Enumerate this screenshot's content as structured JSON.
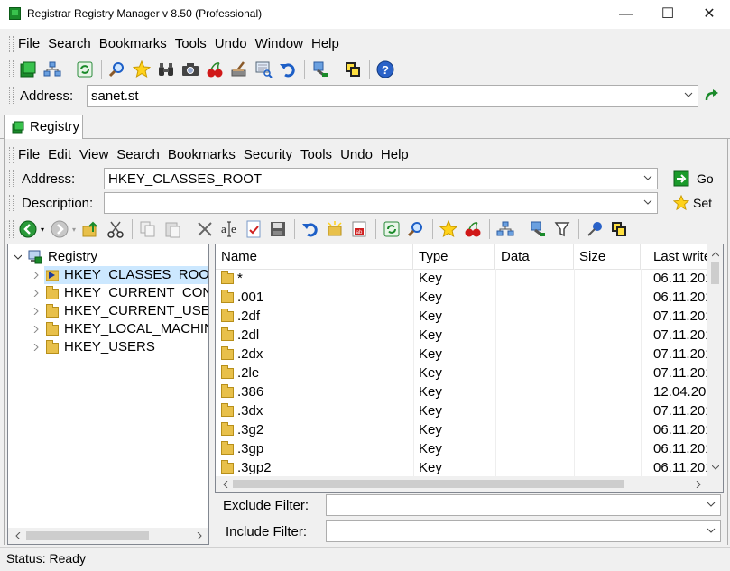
{
  "window": {
    "title": "Registrar Registry Manager v 8.50 (Professional)",
    "min": "—",
    "max": "☐",
    "close": "✕"
  },
  "main_menu": [
    "File",
    "Search",
    "Bookmarks",
    "Tools",
    "Undo",
    "Window",
    "Help"
  ],
  "main_address": {
    "label": "Address:",
    "value": "sanet.st"
  },
  "tab": {
    "label": "Registry"
  },
  "sub_menu": [
    "File",
    "Edit",
    "View",
    "Search",
    "Bookmarks",
    "Security",
    "Tools",
    "Undo",
    "Help"
  ],
  "reg_address": {
    "label": "Address:",
    "value": "HKEY_CLASSES_ROOT",
    "go_label": "Go"
  },
  "description": {
    "label": "Description:",
    "value": "",
    "set_label": "Set"
  },
  "tree": {
    "root": "Registry",
    "items": [
      "HKEY_CLASSES_ROOT",
      "HKEY_CURRENT_CONFIG",
      "HKEY_CURRENT_USER",
      "HKEY_LOCAL_MACHINE",
      "HKEY_USERS"
    ]
  },
  "list": {
    "columns": [
      "Name",
      "Type",
      "Data",
      "Size",
      "Last write"
    ],
    "rows": [
      {
        "name": "*",
        "type": "Key",
        "data": "",
        "size": "",
        "last": "06.11.201"
      },
      {
        "name": ".001",
        "type": "Key",
        "data": "",
        "size": "",
        "last": "06.11.201"
      },
      {
        "name": ".2df",
        "type": "Key",
        "data": "",
        "size": "",
        "last": "07.11.201"
      },
      {
        "name": ".2dl",
        "type": "Key",
        "data": "",
        "size": "",
        "last": "07.11.201"
      },
      {
        "name": ".2dx",
        "type": "Key",
        "data": "",
        "size": "",
        "last": "07.11.201"
      },
      {
        "name": ".2le",
        "type": "Key",
        "data": "",
        "size": "",
        "last": "07.11.201"
      },
      {
        "name": ".386",
        "type": "Key",
        "data": "",
        "size": "",
        "last": "12.04.201"
      },
      {
        "name": ".3dx",
        "type": "Key",
        "data": "",
        "size": "",
        "last": "07.11.201"
      },
      {
        "name": ".3g2",
        "type": "Key",
        "data": "",
        "size": "",
        "last": "06.11.201"
      },
      {
        "name": ".3gp",
        "type": "Key",
        "data": "",
        "size": "",
        "last": "06.11.201"
      },
      {
        "name": ".3gp2",
        "type": "Key",
        "data": "",
        "size": "",
        "last": "06.11.201"
      }
    ]
  },
  "filters": {
    "exclude_label": "Exclude Filter:",
    "include_label": "Include Filter:"
  },
  "status": {
    "text": "Status: Ready"
  },
  "colors": {
    "selection": "#cce8ff",
    "brand_green": "#1a8a2a",
    "accent_blue": "#1d5fc7"
  }
}
